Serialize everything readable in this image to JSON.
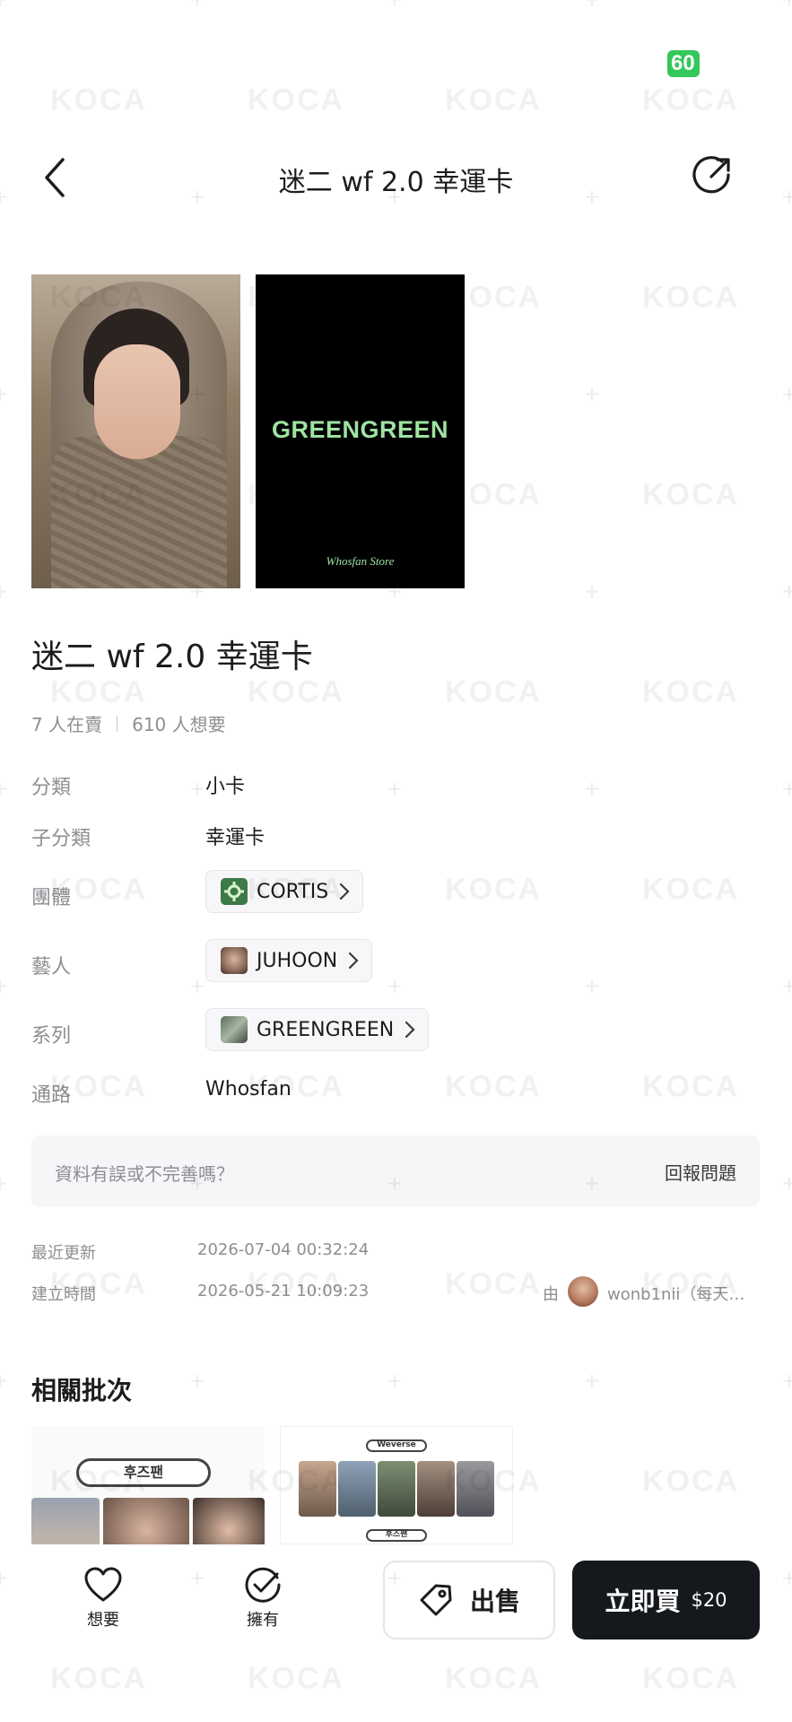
{
  "status": {
    "battery": "60"
  },
  "header": {
    "title": "迷二 wf 2.0 幸運卡"
  },
  "images": {
    "card_front_alt": "Photo card front",
    "card_back_text": "GREENGREEN",
    "card_back_store": "Whosfan Store"
  },
  "product": {
    "title": "迷二 wf 2.0 幸運卡",
    "sellers_text": "7 人在賣",
    "wants_text": "610 人想要"
  },
  "details": {
    "category_label": "分類",
    "category_value": "小卡",
    "subcategory_label": "子分類",
    "subcategory_value": "幸運卡",
    "group_label": "團體",
    "group_value": "CORTIS",
    "artist_label": "藝人",
    "artist_value": "JUHOON",
    "series_label": "系列",
    "series_value": "GREENGREEN",
    "channel_label": "通路",
    "channel_value": "Whosfan"
  },
  "report": {
    "question": "資料有誤或不完善嗎？",
    "link": "回報問題"
  },
  "meta": {
    "updated_label": "最近更新",
    "updated_value": "2026-07-04 00:32:24",
    "created_label": "建立時間",
    "created_value": "2026-05-21 10:09:23",
    "by_label": "由",
    "creator": "wonb1nii（每天…"
  },
  "related": {
    "title": "相關批次",
    "card1_pill": "후즈팬",
    "card2_pill_top": "Weverse",
    "card2_pill_bottom": "후즈팬"
  },
  "bottom_bar": {
    "want_label": "想要",
    "own_label": "擁有",
    "sell_label": "出售",
    "buy_label": "立即買",
    "buy_price": "$20"
  },
  "watermark": {
    "text": "KOCA"
  },
  "colors": {
    "accent_dark": "#15181c",
    "battery": "#34c759",
    "greengreen": "#9ee3a2"
  }
}
